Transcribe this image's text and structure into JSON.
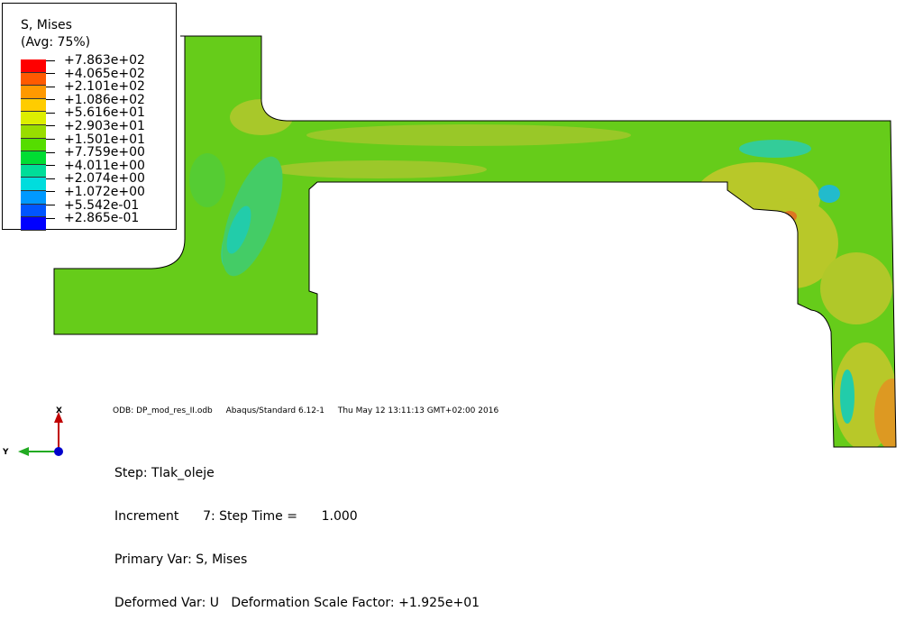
{
  "legend": {
    "title_line1": "S, Mises",
    "title_line2": "(Avg: 75%)",
    "entries": [
      {
        "label": "+7.863e+02",
        "color": "#ff0000"
      },
      {
        "label": "+4.065e+02",
        "color": "#ff5a00"
      },
      {
        "label": "+2.101e+02",
        "color": "#ff9900"
      },
      {
        "label": "+1.086e+02",
        "color": "#ffcc00"
      },
      {
        "label": "+5.616e+01",
        "color": "#ddee00"
      },
      {
        "label": "+2.903e+01",
        "color": "#99dd00"
      },
      {
        "label": "+1.501e+01",
        "color": "#55dd00"
      },
      {
        "label": "+7.759e+00",
        "color": "#00dd33"
      },
      {
        "label": "+4.011e+00",
        "color": "#00dd99"
      },
      {
        "label": "+2.074e+00",
        "color": "#00dddd"
      },
      {
        "label": "+1.072e+00",
        "color": "#0099ff"
      },
      {
        "label": "+5.542e-01",
        "color": "#0055ff"
      },
      {
        "label": "+2.865e-01",
        "color": "#0000ff"
      }
    ]
  },
  "odb": {
    "file": "ODB: DP_mod_res_II.odb",
    "solver": "Abaqus/Standard 6.12-1",
    "date": "Thu May 12 13:11:13 GMT+02:00 2016"
  },
  "info": {
    "step": "Step: Tlak_oleje",
    "increment": "Increment      7: Step Time =      1.000",
    "primary": "Primary Var: S, Mises",
    "deformed": "Deformed Var: U   Deformation Scale Factor: +1.925e+01"
  },
  "triad": {
    "x_label": "X",
    "y_label": "Y"
  },
  "colors": {
    "base_green": "#66cc1a",
    "yellow_zone": "#b8c829",
    "cyan_zone": "#22ccaa",
    "orange_zone": "#dd9922"
  }
}
